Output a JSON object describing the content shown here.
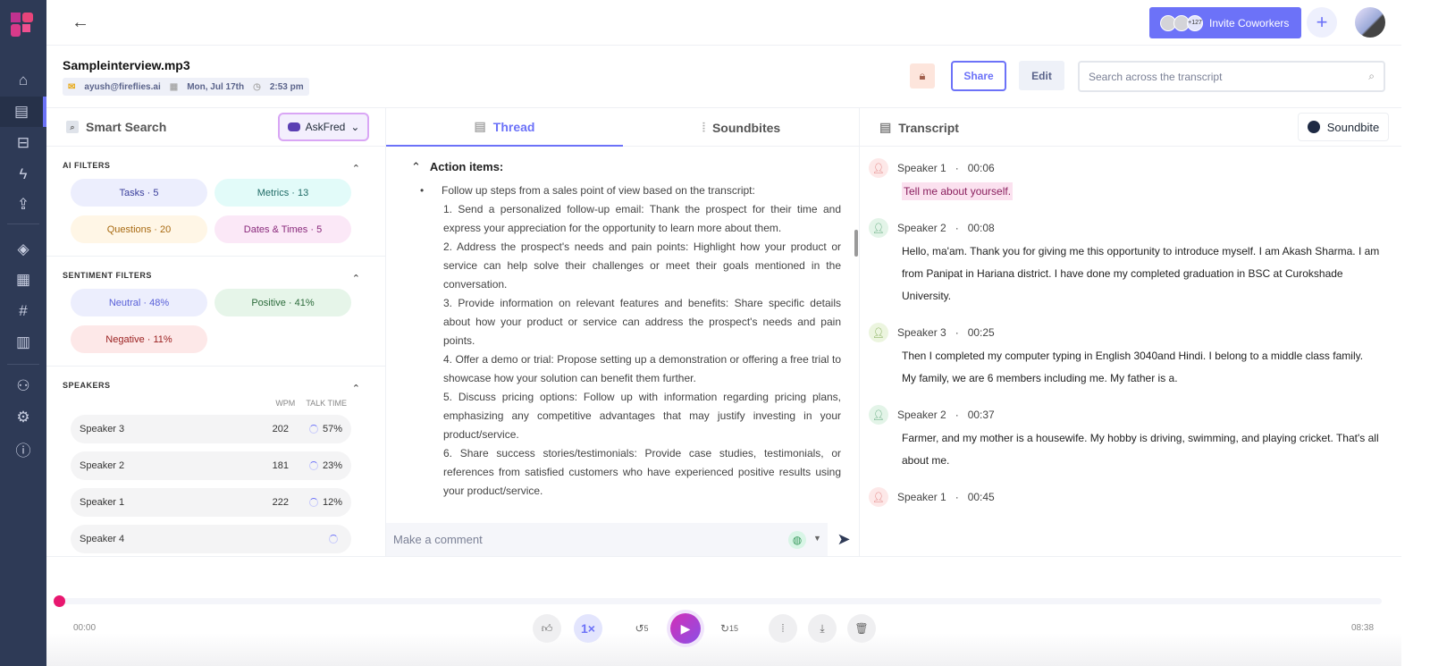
{
  "nav": {
    "items": [
      "home",
      "notes",
      "meetings",
      "bolt",
      "upload",
      "layers",
      "apps",
      "hashtag",
      "analytics",
      "team",
      "settings",
      "info"
    ],
    "active": "notes"
  },
  "topbar": {
    "invite_label": "Invite Coworkers",
    "invite_count": "+127"
  },
  "header": {
    "title": "Sampleinterview.mp3",
    "email": "ayush@fireflies.ai",
    "date": "Mon, Jul 17th",
    "time": "2:53 pm",
    "share_label": "Share",
    "edit_label": "Edit",
    "search_placeholder": "Search across the transcript"
  },
  "left": {
    "title": "Smart Search",
    "askfred": "AskFred",
    "ai_filters": {
      "heading": "AI FILTERS",
      "chips": [
        {
          "label": "Tasks · 5",
          "bg": "#eceefd",
          "color": "#3a3f9c"
        },
        {
          "label": "Metrics · 13",
          "bg": "#e2fbf9",
          "color": "#1f6b66"
        },
        {
          "label": "Questions · 20",
          "bg": "#fff6e6",
          "color": "#a86a12"
        },
        {
          "label": "Dates & Times · 5",
          "bg": "#fbe8f7",
          "color": "#8a2a7c"
        }
      ]
    },
    "sentiment_filters": {
      "heading": "SENTIMENT FILTERS",
      "chips": [
        {
          "label": "Neutral · 48%",
          "bg": "#eceefd",
          "color": "#5960d8"
        },
        {
          "label": "Positive · 41%",
          "bg": "#e6f5e9",
          "color": "#2b6b3a"
        },
        {
          "label": "Negative · 11%",
          "bg": "#fde8e8",
          "color": "#9b2121"
        }
      ]
    },
    "speakers": {
      "heading": "SPEAKERS",
      "col_wpm": "WPM",
      "col_talk": "TALK TIME",
      "rows": [
        {
          "name": "Speaker 3",
          "wpm": "202",
          "talk": "57%"
        },
        {
          "name": "Speaker 2",
          "wpm": "181",
          "talk": "23%"
        },
        {
          "name": "Speaker 1",
          "wpm": "222",
          "talk": "12%"
        },
        {
          "name": "Speaker 4",
          "wpm": "",
          "talk": ""
        }
      ]
    }
  },
  "mid": {
    "tabs": [
      {
        "label": "Thread"
      },
      {
        "label": "Soundbites"
      }
    ],
    "section": "Action items:",
    "bullet": "Follow up steps from a sales point of view based on the transcript:",
    "items": [
      "1. Send a personalized follow-up email: Thank the prospect for their time and express your appreciation for the opportunity to learn more about them.",
      "2. Address the prospect's needs and pain points: Highlight how your product or service can help solve their challenges or meet their goals mentioned in the conversation.",
      "3. Provide information on relevant features and benefits: Share specific details about how your product or service can address the prospect's needs and pain points.",
      "4. Offer a demo or trial: Propose setting up a demonstration or offering a free trial to showcase how your solution can benefit them further.",
      "5. Discuss pricing options: Follow up with information regarding pricing plans, emphasizing any competitive advantages that may justify investing in your product/service.",
      "6. Share success stories/testimonials: Provide case studies, testimonials, or references from satisfied customers who have experienced positive results using your product/service."
    ],
    "comment_placeholder": "Make a comment"
  },
  "right": {
    "title": "Transcript",
    "soundbite_label": "Soundbite",
    "entries": [
      {
        "speaker": "Speaker 1",
        "time": "00:06",
        "text": "Tell me about yourself.",
        "highlight": true,
        "color": "#e07b7b",
        "bg": "#fde8e8"
      },
      {
        "speaker": "Speaker 2",
        "time": "00:08",
        "text": "Hello, ma'am. Thank you for giving me this opportunity to introduce myself. I am Akash Sharma. I am from Panipat in Hariana district. I have done my completed graduation in BSC at Curokshade University.",
        "color": "#5aa577",
        "bg": "#e3f4e8"
      },
      {
        "speaker": "Speaker 3",
        "time": "00:25",
        "text": "Then I completed my computer typing in English 3040and Hindi. I belong to a middle class family. My family, we are 6 members including me. My father is a.",
        "color": "#7aa64a",
        "bg": "#ecf5df"
      },
      {
        "speaker": "Speaker 2",
        "time": "00:37",
        "text": "Farmer, and my mother is a housewife. My hobby is driving, swimming, and playing cricket. That's all about me.",
        "color": "#5aa577",
        "bg": "#e3f4e8"
      },
      {
        "speaker": "Speaker 1",
        "time": "00:45",
        "text": "",
        "color": "#e07b7b",
        "bg": "#fde8e8"
      }
    ]
  },
  "player": {
    "current": "00:00",
    "duration": "08:38",
    "progress": 0,
    "speed": "1×",
    "rewind": "5",
    "forward": "15"
  }
}
